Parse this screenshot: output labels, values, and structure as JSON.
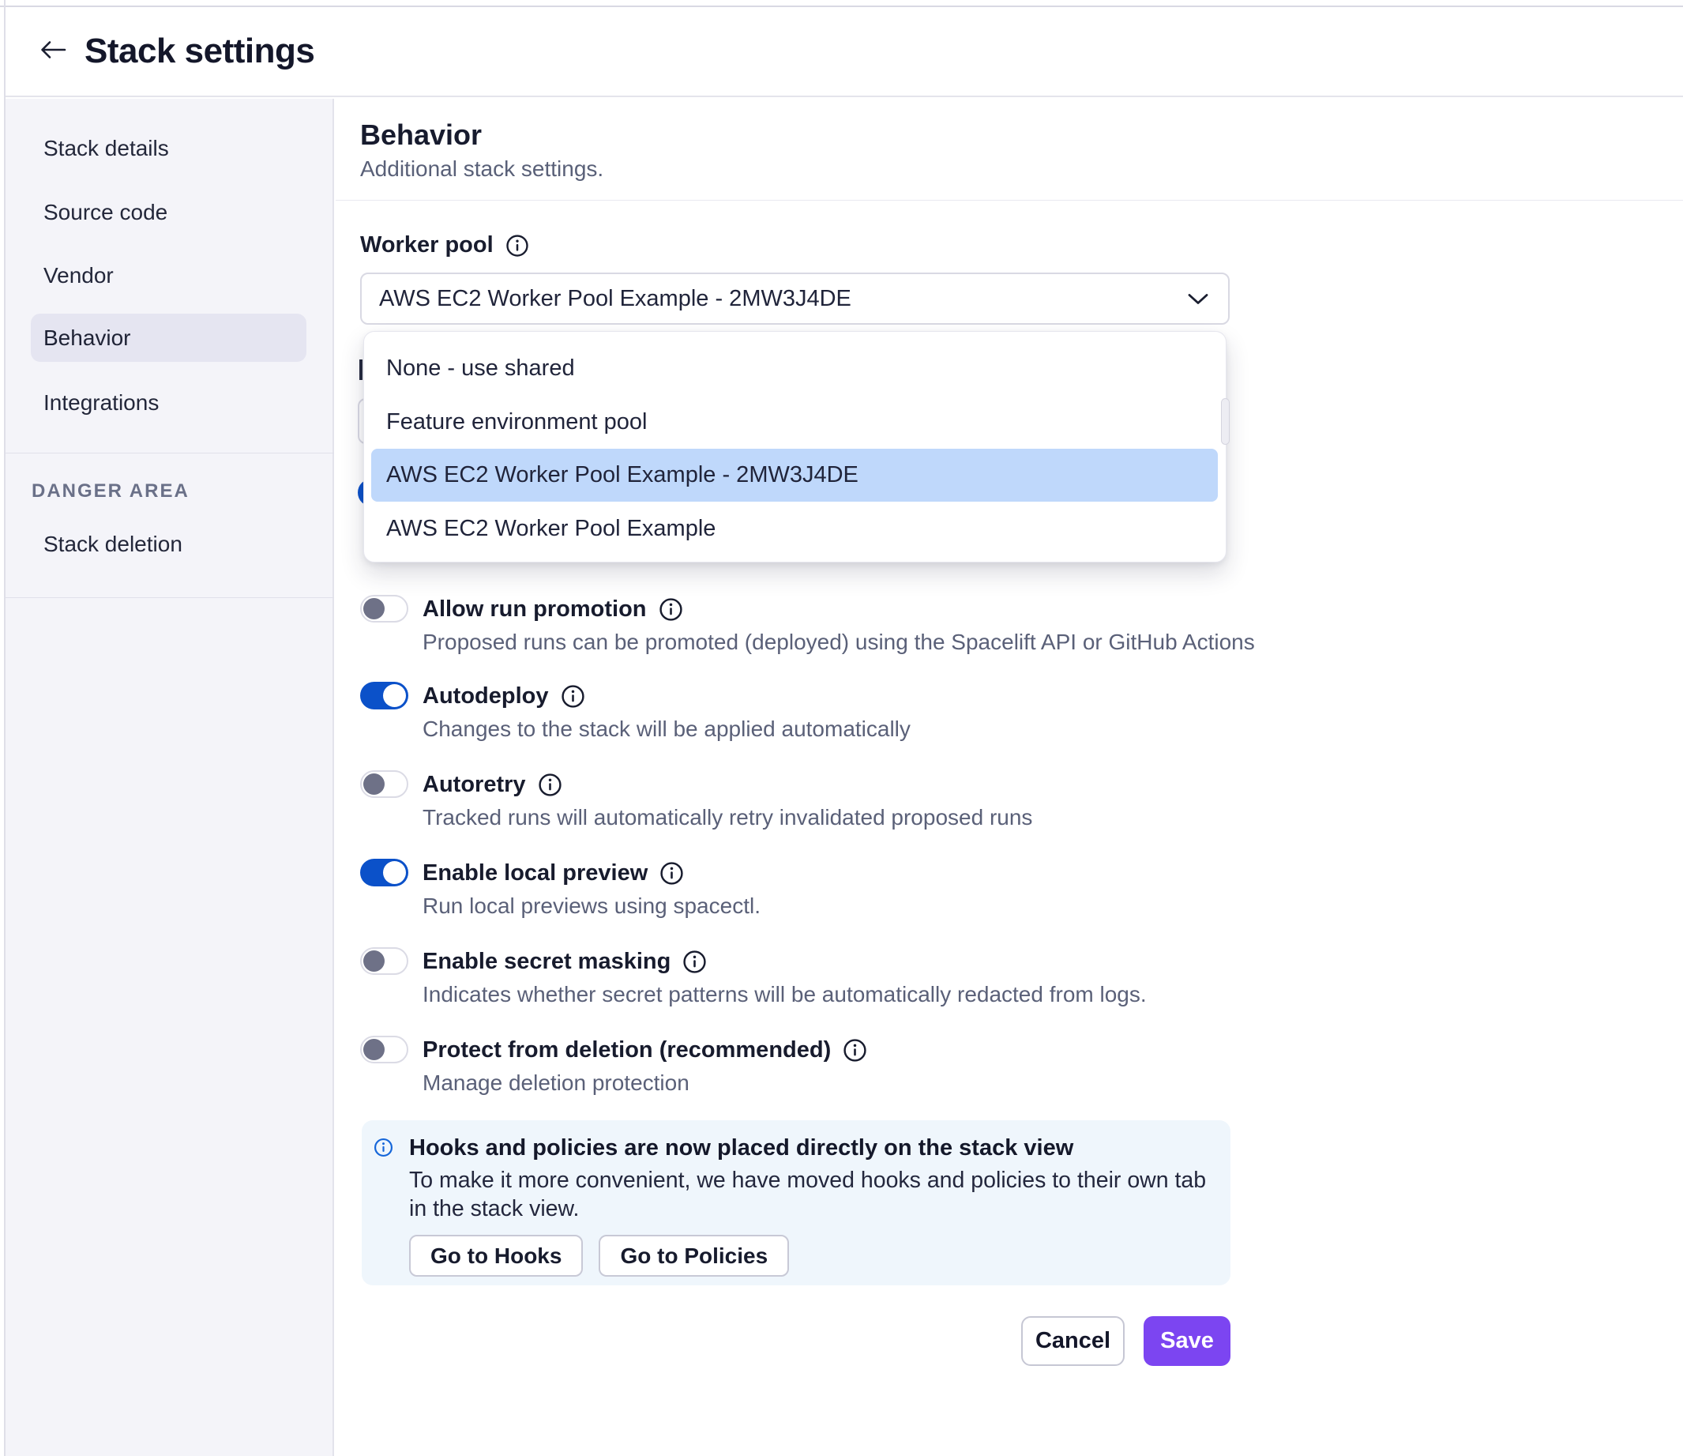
{
  "header": {
    "title": "Stack settings"
  },
  "sidebar": {
    "items": [
      {
        "label": "Stack details",
        "active": false
      },
      {
        "label": "Source code",
        "active": false
      },
      {
        "label": "Vendor",
        "active": false
      },
      {
        "label": "Behavior",
        "active": true
      },
      {
        "label": "Integrations",
        "active": false
      }
    ],
    "danger_heading": "DANGER AREA",
    "danger_items": [
      {
        "label": "Stack deletion"
      }
    ]
  },
  "main": {
    "heading": "Behavior",
    "subheading": "Additional stack settings.",
    "worker_pool": {
      "label": "Worker pool",
      "selected": "AWS EC2 Worker Pool Example - 2MW3J4DE",
      "options": [
        {
          "label": "None - use shared",
          "highlighted": false
        },
        {
          "label": "Feature environment pool",
          "highlighted": false
        },
        {
          "label": "AWS EC2 Worker Pool Example - 2MW3J4DE",
          "highlighted": true
        },
        {
          "label": "AWS EC2 Worker Pool Example",
          "highlighted": false
        }
      ]
    },
    "toggles": [
      {
        "label": "Allow run promotion",
        "description": "Proposed runs can be promoted (deployed) using the Spacelift API or GitHub Actions",
        "on": false
      },
      {
        "label": "Autodeploy",
        "description": "Changes to the stack will be applied automatically",
        "on": true
      },
      {
        "label": "Autoretry",
        "description": "Tracked runs will automatically retry invalidated proposed runs",
        "on": false
      },
      {
        "label": "Enable local preview",
        "description": "Run local previews using spacectl.",
        "on": true
      },
      {
        "label": "Enable secret masking",
        "description": "Indicates whether secret patterns will be automatically redacted from logs.",
        "on": false
      },
      {
        "label": "Protect from deletion (recommended)",
        "description": "Manage deletion protection",
        "on": false
      }
    ],
    "notice": {
      "title": "Hooks and policies are now placed directly on the stack view",
      "body": "To make it more convenient, we have moved hooks and policies to their own tab in the stack view.",
      "buttons": [
        {
          "label": "Go to Hooks"
        },
        {
          "label": "Go to Policies"
        }
      ]
    },
    "actions": {
      "cancel": "Cancel",
      "save": "Save"
    }
  },
  "colors": {
    "accent_blue": "#0B51C9",
    "save_purple": "#7C45F1",
    "option_highlight": "#BFD8FB",
    "notice_bg": "#EFF6FC",
    "notice_icon_blue": "#1566D9",
    "sidebar_bg": "#F4F4F9",
    "active_pill": "#E5E5F1"
  }
}
